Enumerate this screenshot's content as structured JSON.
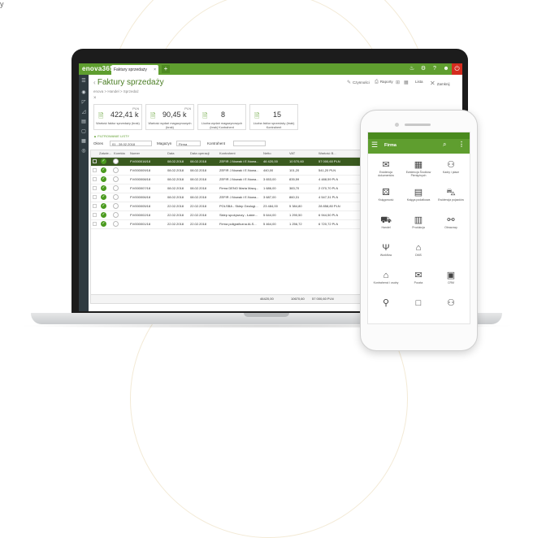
{
  "corner_text": "y",
  "app": {
    "logo": "enova365",
    "tab_label": "Faktury sprzedaży",
    "tab_close": "×",
    "new_tab": "+",
    "top_icons": [
      "bell-icon",
      "settings-icon",
      "help-icon",
      "user-icon"
    ],
    "power_label": "⏻"
  },
  "page": {
    "title": "Faktury sprzedaży",
    "breadcrumb": "enova > Handel > Sprzedaż",
    "close_label": "×"
  },
  "toolbar": {
    "buttons": [
      "Czynności",
      "Raporty",
      "Lista",
      "Zamknij"
    ]
  },
  "kpis": [
    {
      "currency": "PLN",
      "value": "422,41 k",
      "label": "Wartość faktur sprzedaży (brak)"
    },
    {
      "currency": "PLN",
      "value": "90,45 k",
      "label": "Wartość wydań magazynowych (brak)"
    },
    {
      "currency": "",
      "value": "8",
      "label": "Liczba wydań magazynowych (brak) Kontrahent"
    },
    {
      "currency": "",
      "value": "15",
      "label": "Liczba faktur sprzedaży (brak) Kontrahent"
    }
  ],
  "filters": {
    "toggle_label": "▲ FILTROWANIE LISTY",
    "okres_label": "Okres",
    "okres_value": "01 - 28.02.2018",
    "magazyn_label": "Magazyn",
    "magazyn_value": "Firma",
    "kontrahent_label": "Kontrahent",
    "kontrahent_value": ""
  },
  "table": {
    "columns": [
      "Zatwie...",
      "Korekta",
      "Numer",
      "Data",
      "Data operacji",
      "Kontrahent",
      "Netto",
      "VAT",
      "Wartość B..."
    ],
    "rows": [
      [
        "",
        "",
        "FV/000016/18",
        "08.02.2018",
        "08.02.2018",
        "ZEFIR J.Nowak i E.Nowa...",
        "46 420,00",
        "10 570,60",
        "57 000,60 PLN"
      ],
      [
        "",
        "",
        "FV/000009/18",
        "08.02.2018",
        "08.02.2018",
        "ZEFIR J.Nowak i E.Nowa...",
        "440,00",
        "101,20",
        "541,20 PLN"
      ],
      [
        "",
        "",
        "FV/000008/18",
        "08.02.2018",
        "08.02.2018",
        "ZEFIR J.Nowak i E.Nowa...",
        "3 653,00",
        "835,59",
        "4 488,59 PLN"
      ],
      [
        "",
        "",
        "FV/000007/18",
        "08.02.2018",
        "08.02.2018",
        "Firma DENO Maria Mazą...",
        "1 686,00",
        "383,70",
        "2 070,70 PLN"
      ],
      [
        "",
        "",
        "FV/000006/18",
        "08.02.2018",
        "08.02.2018",
        "ZEFIR J.Nowak i E.Nowa...",
        "3 687,00",
        "860,31",
        "4 547,31 PLN"
      ],
      [
        "",
        "",
        "FV/000005/18",
        "22.02.2018",
        "22.02.2018",
        "POLSBA - Sklep Geologi...",
        "23 484,00",
        "5 384,80",
        "28 858,80 PLN"
      ],
      [
        "",
        "",
        "FV/000002/18",
        "22.02.2018",
        "22.02.2018",
        "Sklep spożywczy - Łakie...",
        "5 644,00",
        "1 290,50",
        "6 944,50 PLN"
      ],
      [
        "",
        "",
        "FV/000001/18",
        "22.02.2018",
        "22.02.2018",
        "Firma poligraficzna ALS...",
        "5 464,00",
        "1 256,72",
        "6 720,72 PLN"
      ]
    ],
    "selected_row": 0,
    "totals": [
      "46420,00",
      "10670,60",
      "57 000,60 PLN"
    ]
  },
  "phone": {
    "title": "Firma",
    "menu_icon": "☰",
    "search_icon": "⌕",
    "more_icon": "⋮",
    "items": [
      {
        "icon": "mail-icon",
        "glyph": "✉",
        "label": "Ewidencja dokumentów"
      },
      {
        "icon": "calculator-icon",
        "glyph": "▦",
        "label": "Ewidencja Środków Pieniężnych"
      },
      {
        "icon": "people-icon",
        "glyph": "⚇",
        "label": "Kadry i płace"
      },
      {
        "icon": "dice-icon",
        "glyph": "⚄",
        "label": "Księgowość"
      },
      {
        "icon": "ledger-icon",
        "glyph": "▤",
        "label": "Księga podatkowa"
      },
      {
        "icon": "car-icon",
        "glyph": "⛍",
        "label": "Ewidencja pojazdów"
      },
      {
        "icon": "cart-icon",
        "glyph": "⛟",
        "label": "Handel"
      },
      {
        "icon": "factory-icon",
        "glyph": "▥",
        "label": "Produkcja"
      },
      {
        "icon": "workflow-icon",
        "glyph": "⚯",
        "label": "Obrazowy"
      },
      {
        "icon": "fork-icon",
        "glyph": "Ψ",
        "label": "Workflow"
      },
      {
        "icon": "folder-icon",
        "glyph": "⌂",
        "label": "DMS"
      },
      {
        "icon": "",
        "glyph": "",
        "label": ""
      },
      {
        "icon": "house-icon",
        "glyph": "⌂",
        "label": "Kontrahenci i osoby"
      },
      {
        "icon": "envelope-icon",
        "glyph": "✉",
        "label": "Poczta"
      },
      {
        "icon": "crm-icon",
        "glyph": "▣",
        "label": "CRM"
      },
      {
        "icon": "link-icon",
        "glyph": "⚲",
        "label": ""
      },
      {
        "icon": "box-icon",
        "glyph": "□",
        "label": ""
      },
      {
        "icon": "user-icon",
        "glyph": "⚇",
        "label": ""
      }
    ]
  }
}
